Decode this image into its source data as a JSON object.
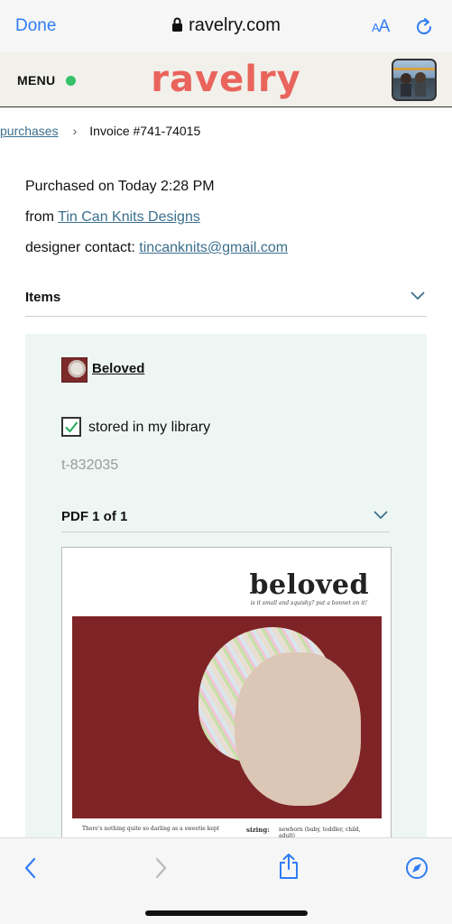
{
  "browser": {
    "done_label": "Done",
    "url": "ravelry.com",
    "aa_label_small": "A",
    "aa_label_large": "A"
  },
  "header": {
    "menu_label": "MENU",
    "logo_text": "ravelry",
    "status_color": "#35c06a",
    "logo_color": "#e9645c"
  },
  "breadcrumb": {
    "parent_label": "purchases",
    "current_label": "Invoice #741-74015"
  },
  "purchase": {
    "purchased_prefix": "Purchased on ",
    "purchased_value": "Today 2:28 PM",
    "from_prefix": "from ",
    "from_link": "Tin Can Knits Designs",
    "contact_prefix": "designer contact: ",
    "contact_link": "tincanknits@gmail.com"
  },
  "items_section": {
    "label": "Items"
  },
  "item": {
    "title": "Beloved",
    "library_label": "stored in my library",
    "library_checked": true,
    "code": "t-832035",
    "pdf_label": "PDF 1 of 1"
  },
  "pdf_preview": {
    "title": "beloved",
    "tagline": "is it small and squishy? put a bonnet on it!",
    "footer_text": "There's nothing quite so darling as a sweetie kept",
    "sizing_label": "sizing:",
    "sizing_value": "newborn (baby, toddler, child, adult)"
  },
  "toolbar": {
    "icons": [
      "back-icon",
      "forward-icon",
      "share-icon",
      "compass-icon"
    ]
  },
  "colors": {
    "link": "#3b6f8e",
    "ios_blue": "#2f7cf6",
    "panel_bg": "#eef6f3"
  }
}
